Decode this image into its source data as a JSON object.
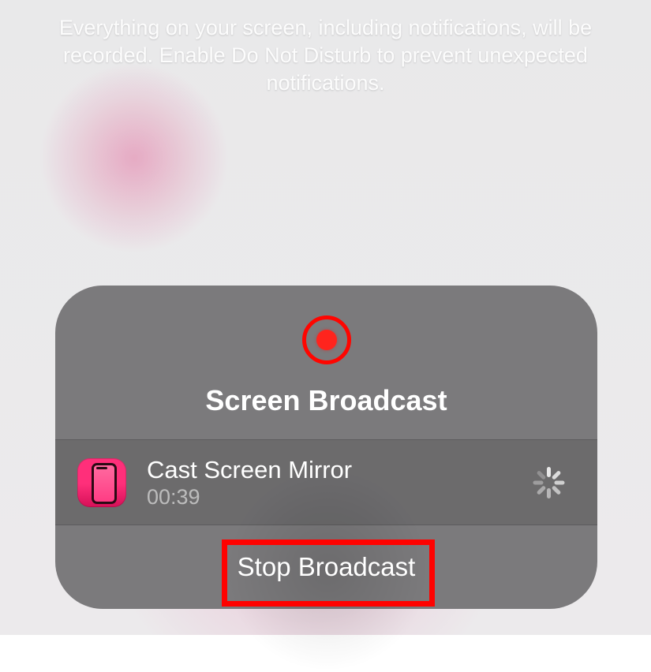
{
  "info_text": "Everything on your screen, including notifications, will be recorded. Enable Do Not Disturb to prevent unexpected notifications.",
  "panel": {
    "title": "Screen Broadcast",
    "record_icon": "record-icon",
    "destination": {
      "app_name": "Cast Screen Mirror",
      "elapsed": "00:39",
      "status_icon": "spinner-icon"
    },
    "stop_label": "Stop Broadcast"
  }
}
